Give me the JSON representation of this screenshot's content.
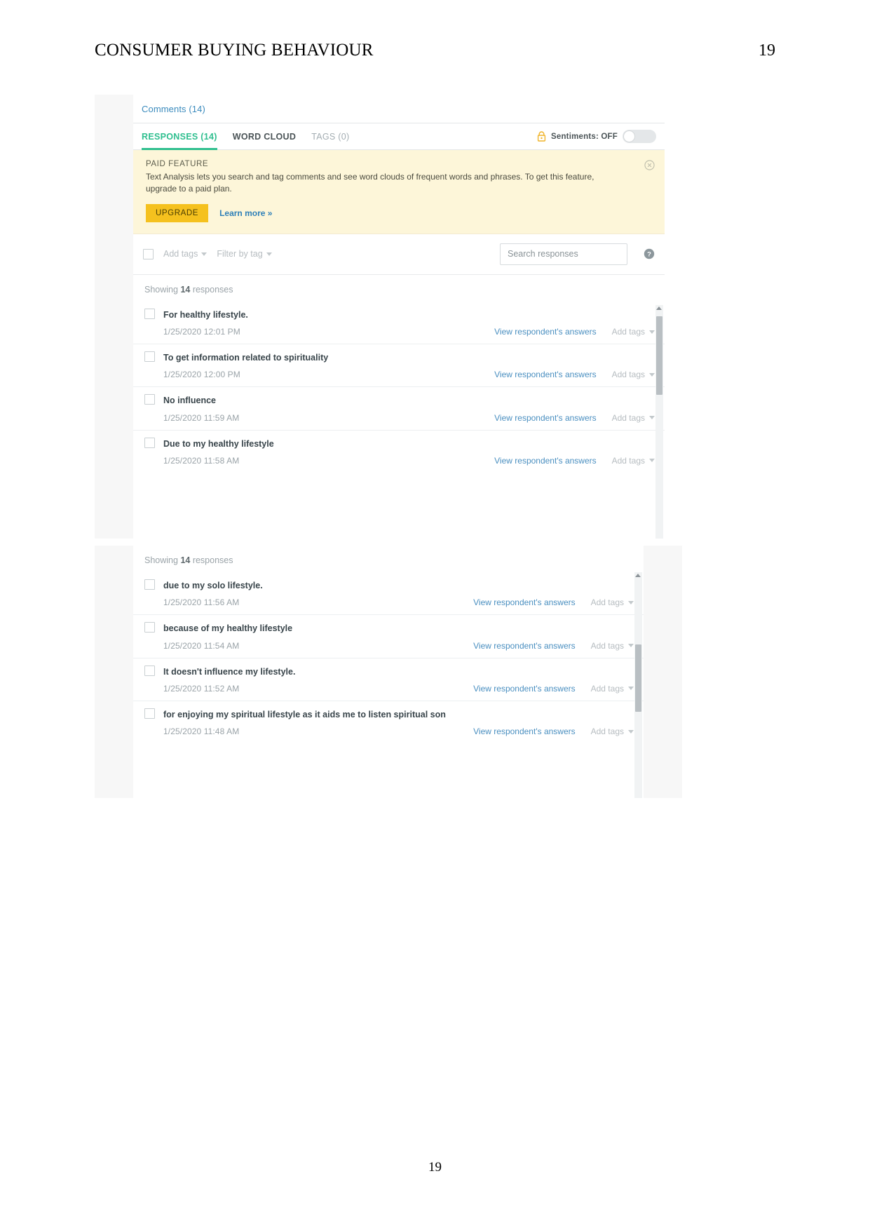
{
  "document": {
    "header_title": "CONSUMER BUYING BEHAVIOUR",
    "header_page": "19",
    "footer_page": "19"
  },
  "app": {
    "comments_link": "Comments (14)",
    "tabs": [
      {
        "label": "RESPONSES (14)",
        "state": "active"
      },
      {
        "label": "WORD CLOUD",
        "state": "normal"
      },
      {
        "label": "TAGS (0)",
        "state": "muted"
      }
    ],
    "sentiments": {
      "lock_icon": "lock-icon",
      "label": "Sentiments: OFF",
      "toggle_state": "off"
    },
    "banner": {
      "title": "PAID FEATURE",
      "body": "Text Analysis lets you search and tag comments and see word clouds of frequent words and phrases. To get this feature, upgrade to a paid plan.",
      "upgrade_label": "UPGRADE",
      "learn_more_label": "Learn more »",
      "close_icon": "close-circle-icon",
      "background_color": "#fdf6d9",
      "upgrade_color": "#f5c11e"
    },
    "toolbar": {
      "select_all_checkbox": "",
      "add_tags_label": "Add tags",
      "filter_by_tag_label": "Filter by tag",
      "search_placeholder": "Search responses",
      "search_value": "",
      "search_icon": "search-icon",
      "help_icon": "help-circle-icon"
    },
    "accent_color": "#2fbf8f",
    "link_color": "#4a8fc0"
  },
  "panel1": {
    "showing_prefix": "Showing ",
    "showing_count": "14",
    "showing_suffix": " responses",
    "rows": [
      {
        "text": "For healthy lifestyle.",
        "date": "1/25/2020 12:01 PM",
        "view_label": "View respondent's answers",
        "add_tags_label": "Add tags"
      },
      {
        "text": "To get information related to spirituality",
        "date": "1/25/2020 12:00 PM",
        "view_label": "View respondent's answers",
        "add_tags_label": "Add tags"
      },
      {
        "text": "No influence",
        "date": "1/25/2020 11:59 AM",
        "view_label": "View respondent's answers",
        "add_tags_label": "Add tags"
      },
      {
        "text": "Due to my healthy lifestyle",
        "date": "1/25/2020 11:58 AM",
        "view_label": "View respondent's answers",
        "add_tags_label": "Add tags"
      }
    ]
  },
  "panel2": {
    "showing_prefix": "Showing ",
    "showing_count": "14",
    "showing_suffix": " responses",
    "rows": [
      {
        "text": "due to my solo lifestyle.",
        "date": "1/25/2020 11:56 AM",
        "view_label": "View respondent's answers",
        "add_tags_label": "Add tags"
      },
      {
        "text": "because of my healthy lifestyle",
        "date": "1/25/2020 11:54 AM",
        "view_label": "View respondent's answers",
        "add_tags_label": "Add tags"
      },
      {
        "text": "It doesn't influence my lifestyle.",
        "date": "1/25/2020 11:52 AM",
        "view_label": "View respondent's answers",
        "add_tags_label": "Add tags"
      },
      {
        "text": "for enjoying my spiritual lifestyle as it aids me to listen spiritual son",
        "date": "1/25/2020 11:48 AM",
        "view_label": "View respondent's answers",
        "add_tags_label": "Add tags"
      }
    ]
  }
}
